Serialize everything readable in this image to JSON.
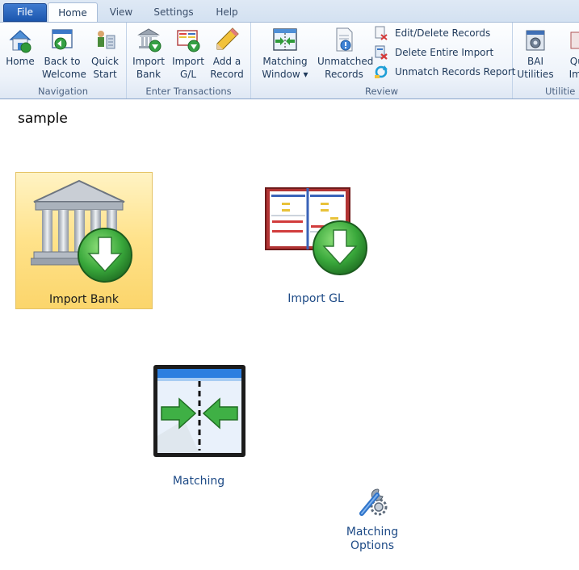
{
  "tabs": {
    "file": "File",
    "home": "Home",
    "view": "View",
    "settings": "Settings",
    "help": "Help"
  },
  "ribbon": {
    "navigation": {
      "caption": "Navigation",
      "home": "Home",
      "back_to_welcome": "Back to\nWelcome",
      "quick_start": "Quick\nStart"
    },
    "enter_transactions": {
      "caption": "Enter Transactions",
      "import_bank": "Import\nBank",
      "import_gl": "Import\nG/L",
      "add_record": "Add a\nRecord"
    },
    "review": {
      "caption": "Review",
      "matching_window": "Matching\nWindow ▾",
      "unmatched_records": "Unmatched\nRecords",
      "edit_delete": "Edit/Delete Records",
      "delete_import": "Delete Entire Import",
      "unmatch_report": "Unmatch Records Report"
    },
    "utilities": {
      "caption": "Utilitie",
      "bai": "BAI\nUtilities",
      "quick_import": "Qui\nImp"
    }
  },
  "main": {
    "title": "sample",
    "tiles": {
      "import_bank": "Import Bank",
      "import_gl": "Import GL",
      "matching": "Matching",
      "matching_options": "Matching\nOptions"
    }
  },
  "colors": {
    "accent": "#1b56ae",
    "selected_tile": "#ffe28a",
    "link_text": "#1d4a86"
  }
}
